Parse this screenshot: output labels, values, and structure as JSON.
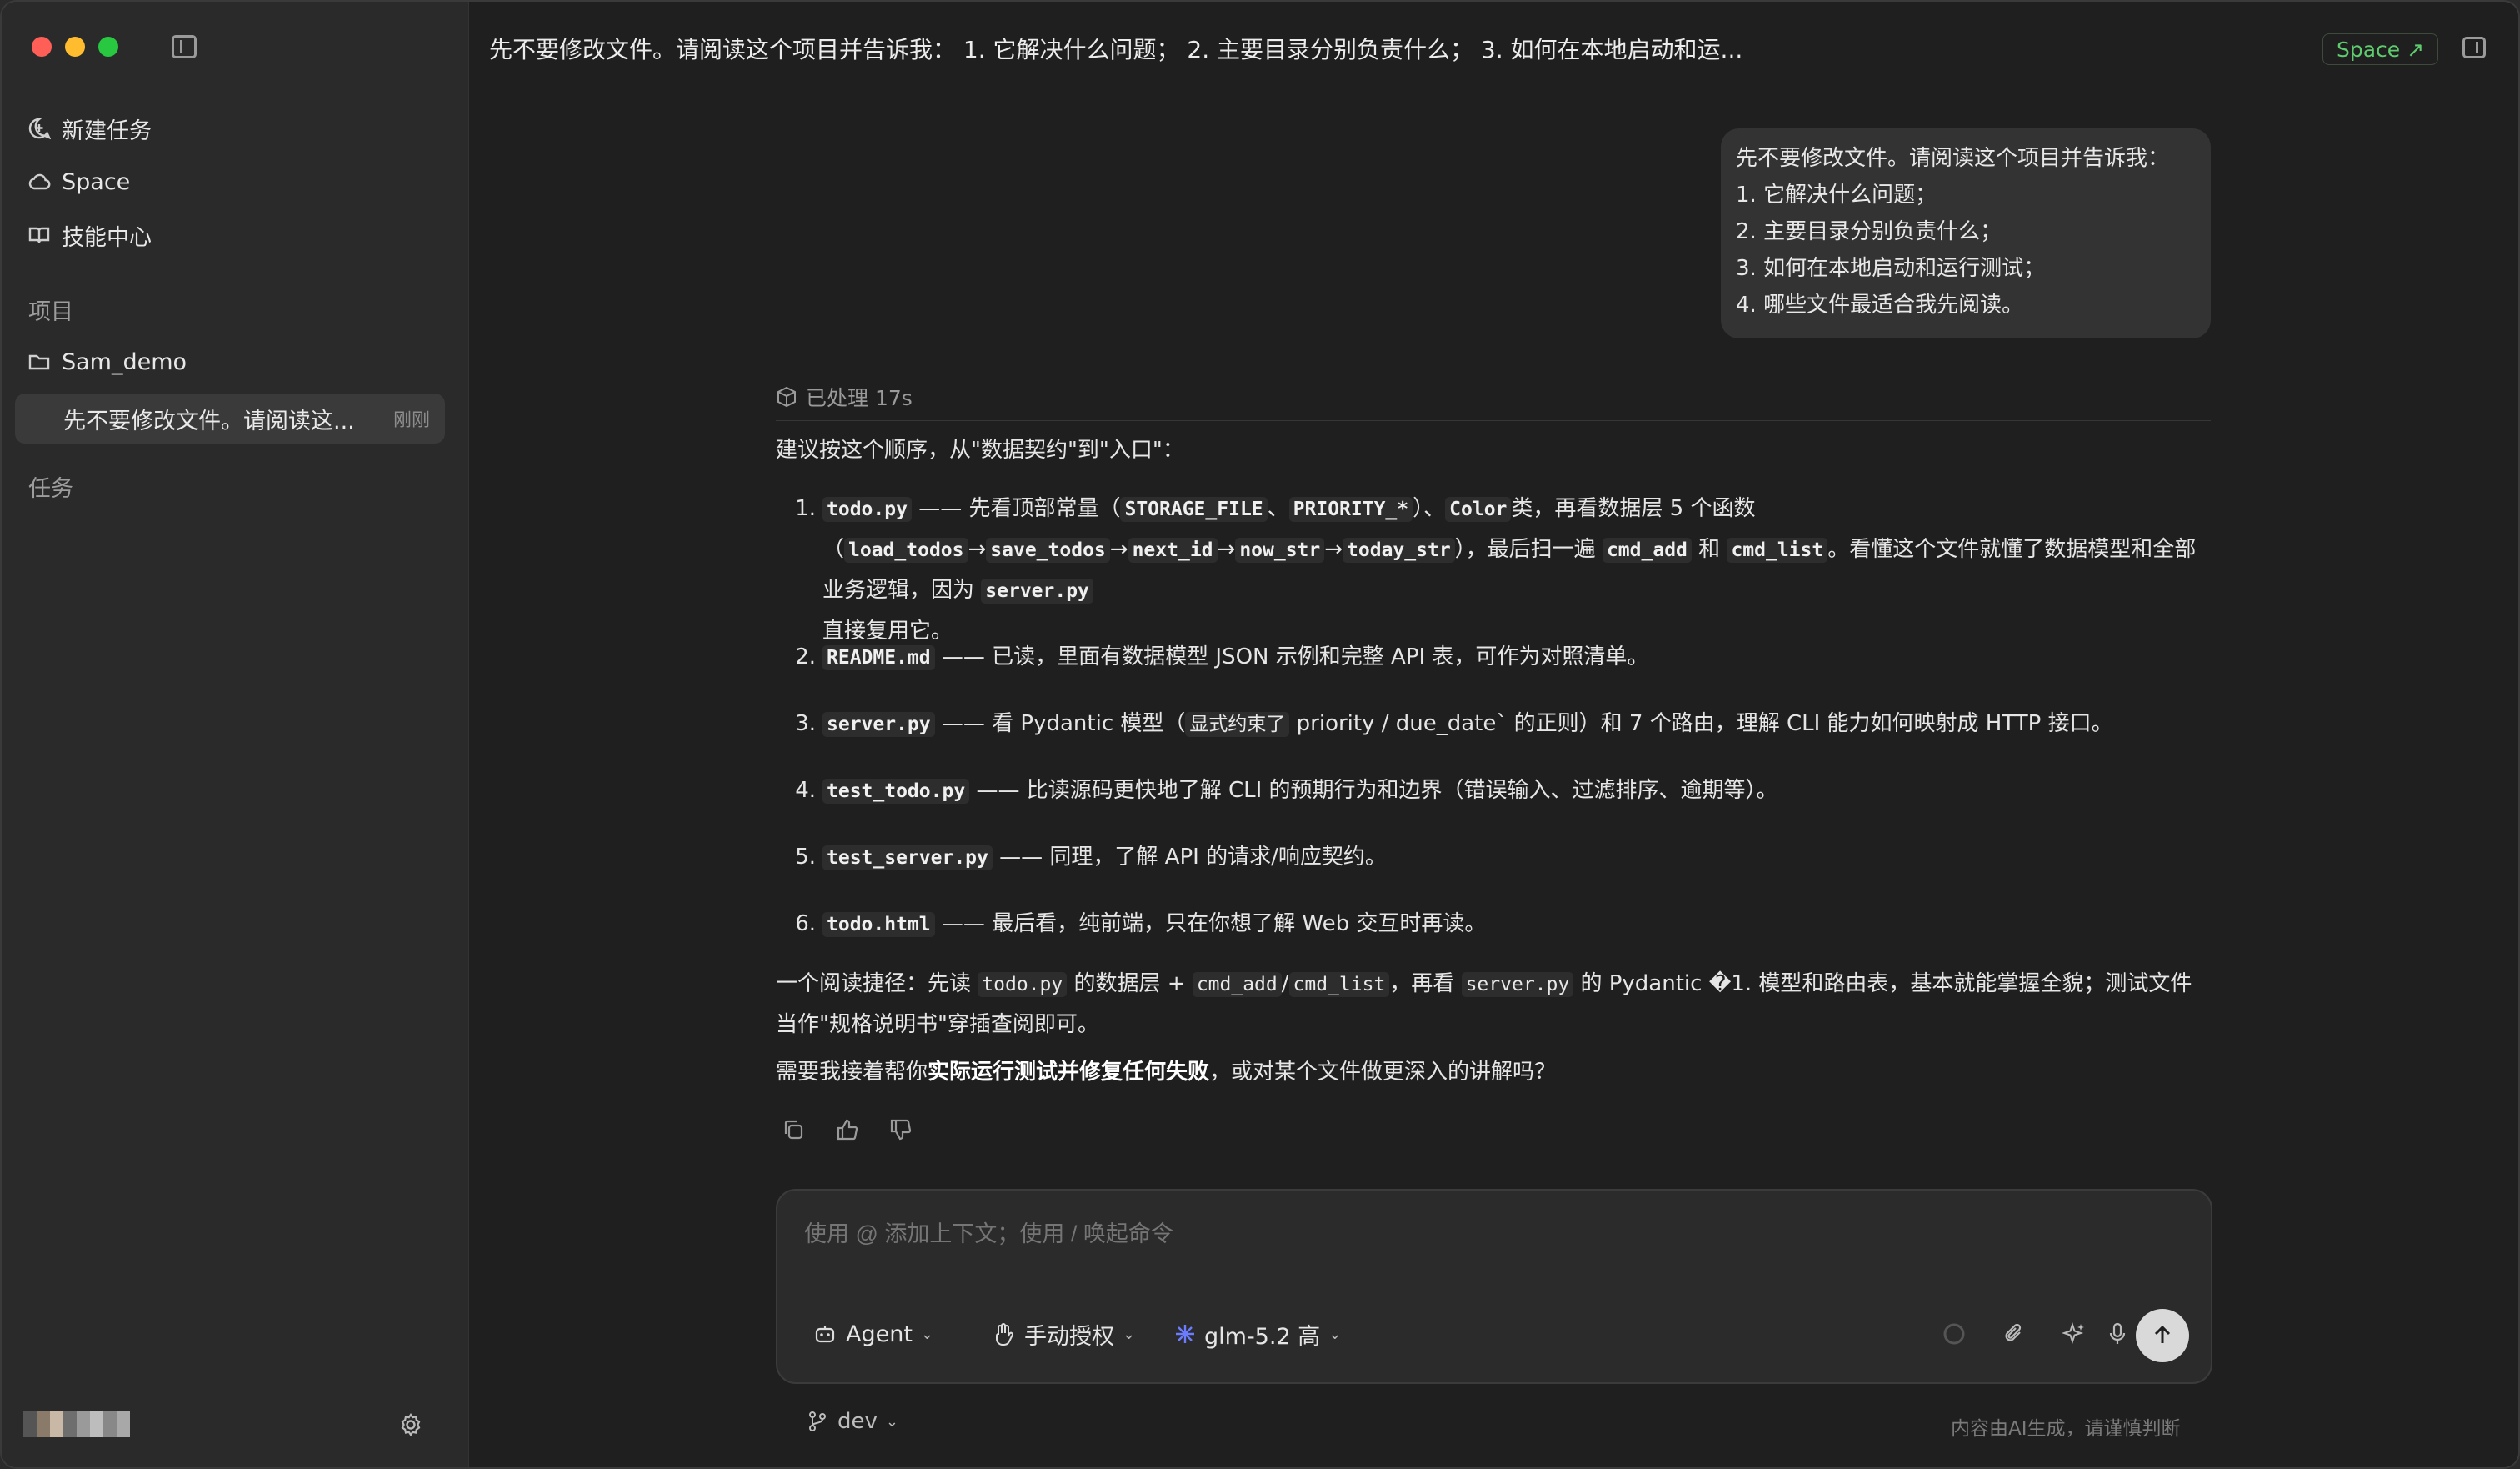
{
  "sidebar": {
    "nav": [
      {
        "label": "新建任务",
        "icon": "new-task-icon"
      },
      {
        "label": "Space",
        "icon": "cloud-icon"
      },
      {
        "label": "技能中心",
        "icon": "book-icon"
      }
    ],
    "projects_label": "项目",
    "project_name": "Sam_demo",
    "active_task": {
      "title": "先不要修改文件。请阅读这...",
      "time": "刚刚"
    },
    "tasks_label": "任务"
  },
  "header": {
    "title": "先不要修改文件。请阅读这个项目并告诉我： 1. 它解决什么问题； 2. 主要目录分别负责什么； 3. 如何在本地启动和运...",
    "space_button": "Space ↗",
    "accent": "#5ecb6e"
  },
  "user_message": {
    "lines": [
      "先不要修改文件。请阅读这个项目并告诉我：",
      "1. 它解决什么问题；",
      "2. 主要目录分别负责什么；",
      "3. 如何在本地启动和运行测试；",
      "4. 哪些文件最适合我先阅读。"
    ]
  },
  "assistant": {
    "processed": "已处理 17s",
    "intro": "建议按这个顺序，从\"数据契约\"到\"入口\"：",
    "items": [
      {
        "num": "1.",
        "file": "todo.py",
        "t1": "—— 先看顶部常量（",
        "c1": "STORAGE_FILE",
        "t2": "、",
        "c2": "PRIORITY_*",
        "t3": "）、",
        "c3": "Color",
        "t4": "类，再看数据层 5 个函数（",
        "c4": "load_todos",
        "t5": "→",
        "c5": "save_todos",
        "t6": "→",
        "c6": "next_id",
        "t7": "→",
        "c7": "now_str",
        "t8": "→",
        "c8": "today_str",
        "t9": "），最后扫一遍",
        "c9": "cmd_add",
        "t10": "和",
        "c10": "cmd_list",
        "t11": "。看懂这个文件就懂了数据模型和全部业务逻辑，因为",
        "c11": "server.py",
        "t12": "直接复用它。"
      },
      {
        "num": "2.",
        "file": "README.md",
        "text": "—— 已读，里面有数据模型 JSON 示例和完整 API 表，可作为对照清单。"
      },
      {
        "num": "3.",
        "file": "server.py",
        "text_a": "—— 看 Pydantic 模型（",
        "code": "显式约束了",
        "text_b": " priority / due_date` 的正则）和 7 个路由，理解 CLI 能力如何映射成 HTTP 接口。"
      },
      {
        "num": "4.",
        "file": "test_todo.py",
        "text": "—— 比读源码更快地了解 CLI 的预期行为和边界（错误输入、过滤排序、逾期等）。"
      },
      {
        "num": "5.",
        "file": "test_server.py",
        "text": "—— 同理，了解 API 的请求/响应契约。"
      },
      {
        "num": "6.",
        "file": "todo.html",
        "text": "—— 最后看，纯前端，只在你想了解 Web 交互时再读。"
      }
    ],
    "summary": {
      "s1": "一个阅读捷径：先读",
      "c1": "todo.py",
      "s2": "的数据层 +",
      "c2": "cmd_add",
      "s3": "/",
      "c3": "cmd_list",
      "s4": "，再看",
      "c4": "server.py",
      "s5": "的 Pydantic �1. 模型和路由表，基本就能掌握全貌；测试文件当作\"规格说明书\"穿插查阅即可。"
    },
    "closing": {
      "a": "需要我接着帮你",
      "bold": "实际运行测试并修复任何失败",
      "b": "，或对某个文件做更深入的讲解吗？"
    }
  },
  "composer": {
    "placeholder": "使用 @ 添加上下文；使用 / 唤起命令",
    "agent_label": "Agent",
    "permission_label": "手动授权",
    "model_label": "glm-5.2 高"
  },
  "footer": {
    "branch": "dev",
    "disclaimer": "内容由AI生成，请谨慎判断"
  }
}
